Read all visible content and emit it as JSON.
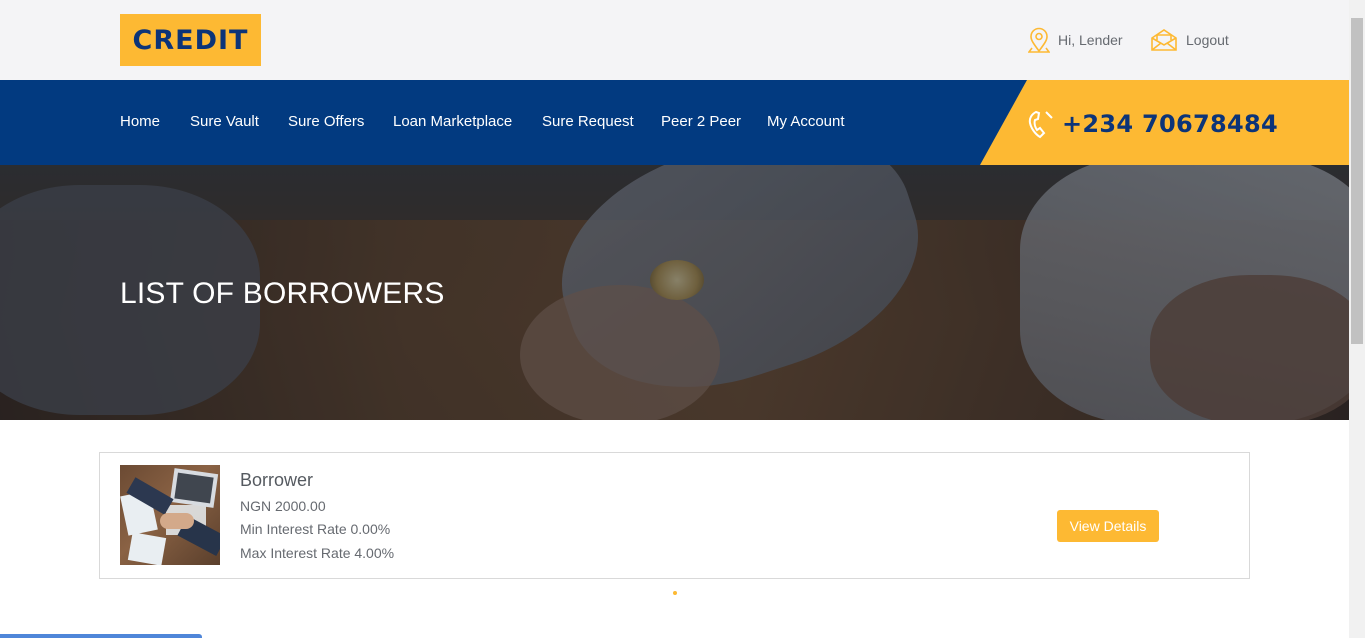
{
  "header": {
    "logo_text": "CREDIT",
    "user_greeting": "Hi, Lender",
    "logout_label": "Logout",
    "user_icon": "map-pin-icon",
    "logout_icon": "envelope-icon"
  },
  "nav": {
    "items": [
      {
        "label": "Home"
      },
      {
        "label": "Sure Vault"
      },
      {
        "label": "Sure Offers"
      },
      {
        "label": "Loan Marketplace"
      },
      {
        "label": "Sure Request"
      },
      {
        "label": "Peer 2 Peer"
      },
      {
        "label": "My Account"
      }
    ],
    "phone": "+234 70678484",
    "phone_icon": "phone-icon"
  },
  "hero": {
    "title": "LIST OF BORROWERS"
  },
  "borrowers": [
    {
      "name": "Borrower",
      "amount": "NGN 2000.00",
      "min_rate": "Min Interest Rate 0.00%",
      "max_rate": "Max Interest Rate 4.00%",
      "button_label": "View Details"
    }
  ],
  "colors": {
    "navy": "#023a80",
    "gold": "#fdb933",
    "topbar": "#f4f4f6"
  }
}
